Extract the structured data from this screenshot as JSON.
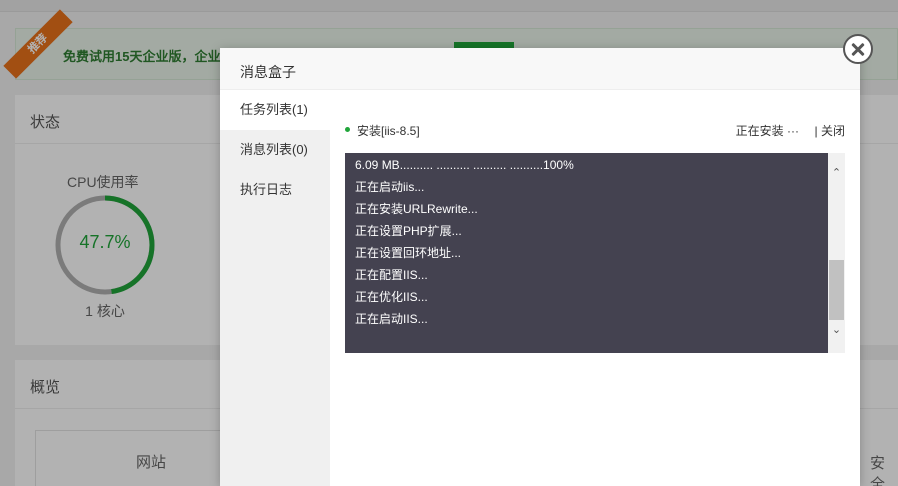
{
  "background": {
    "promo": {
      "ribbon": "推荐",
      "text": "免费试用15天企业版，企业"
    },
    "status_panel": {
      "title": "状态",
      "cpu_label": "CPU使用率",
      "cpu_value": "47.7%",
      "cpu_percent": 47.7,
      "cpu_cores": "1 核心",
      "accent_color": "#20a53a"
    },
    "overview_panel": {
      "title": "概览",
      "site_label": "网站",
      "security_label": "安全"
    }
  },
  "modal": {
    "title": "消息盒子",
    "sidebar": {
      "items": [
        {
          "label": "任务列表(1)",
          "active": true
        },
        {
          "label": "消息列表(0)",
          "active": false
        },
        {
          "label": "执行日志",
          "active": false
        }
      ]
    },
    "task": {
      "name": "安装[iis-8.5]",
      "status": "正在安装 ···",
      "close_label": "| 关闭"
    },
    "console": {
      "lines": [
        "6.09 MB.......... .......... .......... ..........100%",
        "正在启动iis...",
        "正在安装URLRewrite...",
        "正在设置PHP扩展...",
        "正在设置回环地址...",
        "正在配置IIS...",
        "正在优化IIS...",
        "正在启动IIS..."
      ],
      "scroll_up_icon": "chevron-up-icon",
      "scroll_down_icon": "chevron-down-icon"
    },
    "close_icon": "close-icon"
  }
}
